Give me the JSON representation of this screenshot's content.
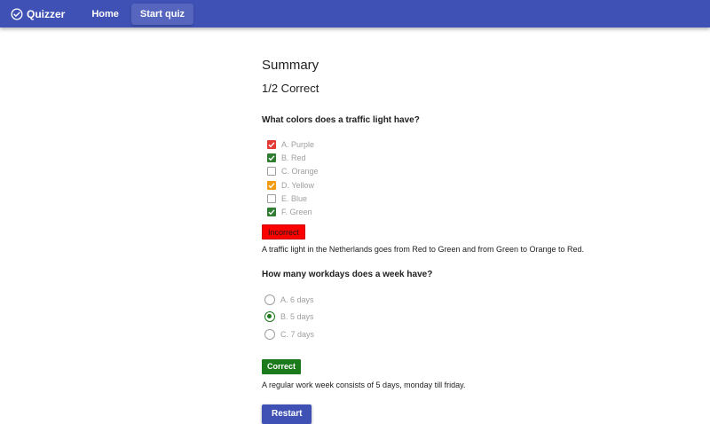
{
  "appbar": {
    "brand": "Quizzer",
    "nav": [
      {
        "label": "Home",
        "active": false
      },
      {
        "label": "Start quiz",
        "active": true
      }
    ]
  },
  "summary": {
    "title": "Summary",
    "score": "1/2 Correct"
  },
  "questions": [
    {
      "text": "What colors does a traffic light have?",
      "type": "checkbox",
      "options": [
        {
          "label": "A. Purple",
          "checked": true,
          "color": "#e53935"
        },
        {
          "label": "B. Red",
          "checked": true,
          "color": "#2e7d32"
        },
        {
          "label": "C. Orange",
          "checked": false,
          "color": null
        },
        {
          "label": "D. Yellow",
          "checked": true,
          "color": "#f39c12"
        },
        {
          "label": "E. Blue",
          "checked": false,
          "color": null
        },
        {
          "label": "F. Green",
          "checked": true,
          "color": "#2e7d32"
        }
      ],
      "result": "Incorrect",
      "explanation": "A traffic light in the Netherlands goes from Red to Green and from Green to Orange to Red."
    },
    {
      "text": "How many workdays does a week have?",
      "type": "radio",
      "options": [
        {
          "label": "A. 6 days",
          "checked": false
        },
        {
          "label": "B. 5 days",
          "checked": true
        },
        {
          "label": "C. 7 days",
          "checked": false
        }
      ],
      "result": "Correct",
      "explanation": "A regular work week consists of 5 days, monday till friday."
    }
  ],
  "restart_label": "Restart",
  "colors": {
    "primary": "#3f51b5",
    "correct": "#1b7a1b",
    "incorrect": "#ff0000"
  }
}
